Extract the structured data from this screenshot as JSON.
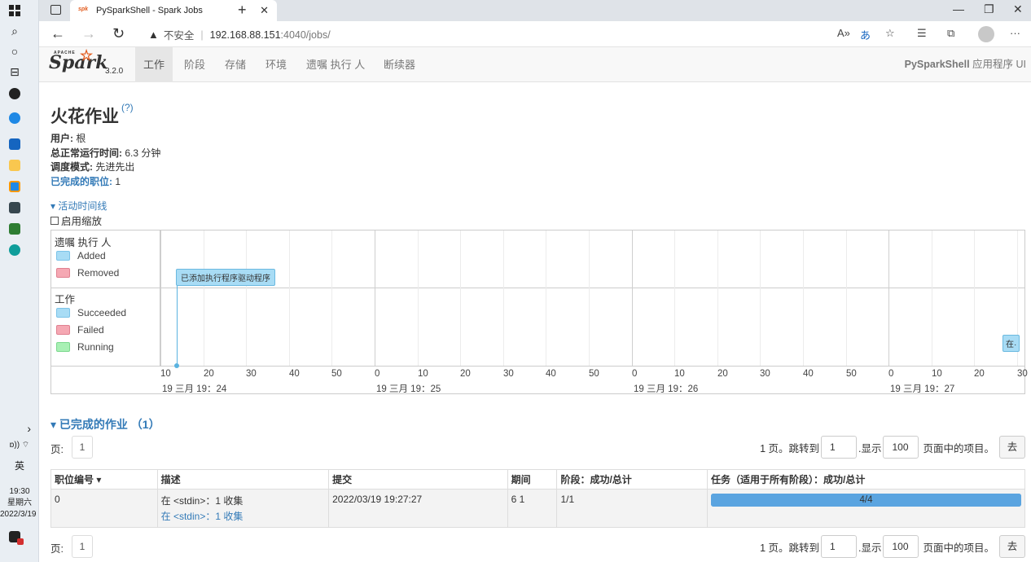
{
  "browser": {
    "tab_title": "PySparkShell - Spark Jobs",
    "security_label": "不安全",
    "url_host": "192.168.88.151",
    "url_rest": ":4040/jobs/"
  },
  "taskbar": {
    "time": "19:30",
    "weekday": "星期六",
    "date": "2022/3/19",
    "ime": "英"
  },
  "spark_nav": {
    "version": "3.2.0",
    "items": [
      "工作",
      "阶段",
      "存储",
      "环境",
      "遗嘱 执行 人",
      "断续器"
    ],
    "app_name_bold": "PySparkShell",
    "app_name_suffix": " 应用程序 UI"
  },
  "page": {
    "title": "火花作业",
    "help": "(?)",
    "user_label": "用户:",
    "user_value": "根",
    "uptime_label": "总正常运行时间:",
    "uptime_value": "6.3 分钟",
    "mode_label": "调度模式:",
    "mode_value": "先进先出",
    "completed_label": "已完成的职位:",
    "completed_value": "1",
    "timeline_toggle": "活动时间线",
    "zoom_label": "启用缩放"
  },
  "timeline": {
    "executors_title": "遗嘱 执行 人",
    "executor_legend": [
      {
        "label": "Added",
        "color": "#a8dcf5"
      },
      {
        "label": "Removed",
        "color": "#f5a8b3"
      }
    ],
    "jobs_title": "工作",
    "job_legend": [
      {
        "label": "Succeeded",
        "color": "#a8dcf5"
      },
      {
        "label": "Failed",
        "color": "#f5a8b3"
      },
      {
        "label": "Running",
        "color": "#a8f0b4"
      }
    ],
    "driver_event": "已添加执行程序驱动程序",
    "job_event": "在·",
    "ticks": [
      "10",
      "20",
      "30",
      "40",
      "50",
      "0",
      "10",
      "20",
      "30",
      "40",
      "50",
      "0",
      "10",
      "20",
      "30",
      "40",
      "50",
      "0",
      "10",
      "20",
      "30"
    ],
    "day_labels": [
      "19 三月 19：24",
      "19 三月 19：25",
      "19 三月 19：26",
      "19 三月 19：27"
    ]
  },
  "completed": {
    "section_title": "已完成的作业 （1）",
    "page_label": "页:",
    "page_value": "1",
    "pages_text": "1 页。跳转到",
    "jump_value": "1",
    "show_text": ".显示",
    "size_value": "100",
    "items_text": "页面中的项目。",
    "go_label": "去",
    "columns": [
      "职位编号 ▾",
      "描述",
      "提交",
      "期间",
      "阶段：成功/总计",
      "任务（适用于所有阶段）：成功/总计"
    ],
    "rows": [
      {
        "id": "0",
        "desc": "在 <stdin>：1 收集",
        "desc_link": "在 <stdin>：1 收集",
        "submitted": "2022/03/19 19:27:27",
        "duration": "6 1",
        "stages": "1/1",
        "tasks": "4/4",
        "tasks_fraction": 1.0
      }
    ]
  }
}
